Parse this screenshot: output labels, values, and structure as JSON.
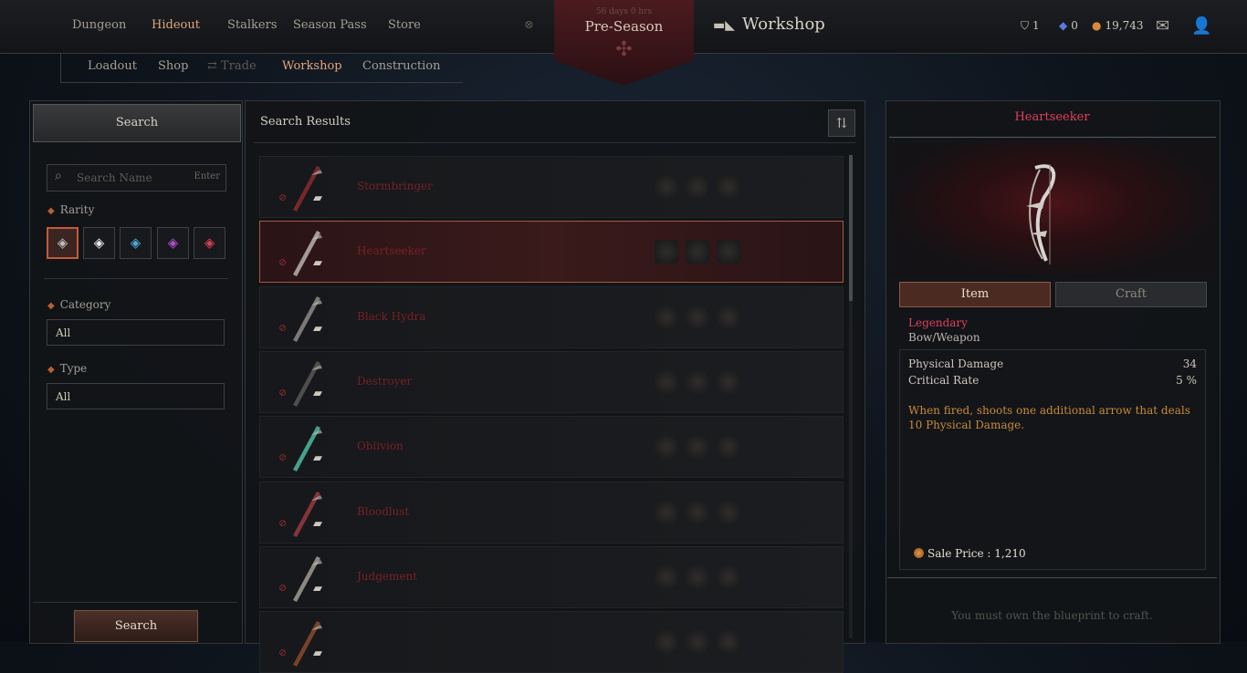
{
  "top_nav": {
    "items": [
      "Dungeon",
      "Hideout",
      "Stalkers",
      "Season Pass",
      "Store"
    ],
    "active": "Hideout"
  },
  "banner": {
    "small_text": "56 days 0 hrs",
    "title": "Pre-Season"
  },
  "page_title": "Workshop",
  "currencies": {
    "shield": "1",
    "blue": "0",
    "gold": "19,743"
  },
  "sub_nav": {
    "items": [
      "Loadout",
      "Shop",
      "Trade",
      "Workshop",
      "Construction"
    ],
    "active": "Workshop",
    "disabled": "Trade"
  },
  "filters": {
    "header_button": "Search",
    "search_placeholder": "Search Name",
    "enter_label": "Enter",
    "rarity_label": "Rarity",
    "rarity_colors": [
      "#bdbdbd",
      "#e8e8e8",
      "#4fa8d8",
      "#b04fc8",
      "#d8405a"
    ],
    "category_label": "Category",
    "category_value": "All",
    "type_label": "Type",
    "type_value": "All",
    "search_button": "Search"
  },
  "results": {
    "title": "Search Results",
    "items": [
      {
        "name": "Stormbringer",
        "selected": false
      },
      {
        "name": "Heartseeker",
        "selected": true
      },
      {
        "name": "Black Hydra",
        "selected": false
      },
      {
        "name": "Destroyer",
        "selected": false
      },
      {
        "name": "Oblivion",
        "selected": false
      },
      {
        "name": "Bloodlust",
        "selected": false
      },
      {
        "name": "Judgement",
        "selected": false
      },
      {
        "name": "",
        "selected": false
      }
    ]
  },
  "detail": {
    "title": "Heartseeker",
    "tab_item": "Item",
    "tab_craft": "Craft",
    "rarity": "Legendary",
    "type": "Bow/Weapon",
    "stats": [
      {
        "label": "Physical Damage",
        "value": "34"
      },
      {
        "label": "Critical Rate",
        "value": "5 %"
      }
    ],
    "effect": "When fired, shoots one additional arrow that deals 10 Physical Damage.",
    "sale_label": "Sale Price : 1,210",
    "craft_note": "You must own the blueprint to craft."
  }
}
